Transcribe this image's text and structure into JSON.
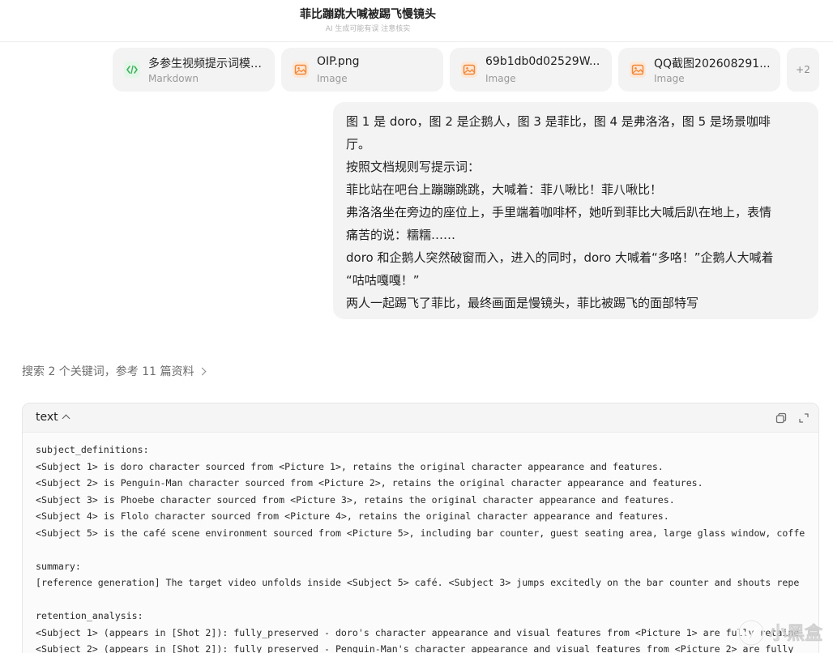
{
  "header": {
    "title": "菲比蹦跳大喊被踢飞慢镜头",
    "subtitle": "AI 生成可能有误 注意核实"
  },
  "attachments": [
    {
      "name": "多参生视频提示词模板...",
      "type": "Markdown",
      "icon": "markdown-code-icon"
    },
    {
      "name": "OIP.png",
      "type": "Image",
      "icon": "image-icon"
    },
    {
      "name": "69b1db0d02529W...",
      "type": "Image",
      "icon": "image-icon"
    },
    {
      "name": "QQ截图202608291...",
      "type": "Image",
      "icon": "image-icon"
    }
  ],
  "attachments_more": "+2",
  "user_message": {
    "lines": [
      "图 1 是 doro，图 2 是企鹅人，图 3 是菲比，图 4 是弗洛洛，图 5 是场景咖啡",
      "厅。",
      "按照文档规则写提示词：",
      "菲比站在吧台上蹦蹦跳跳，大喊着：菲八啾比！菲八啾比！",
      "弗洛洛坐在旁边的座位上，手里端着咖啡杯，她听到菲比大喊后趴在地上，表情",
      "痛苦的说：糯糯……",
      "doro 和企鹅人突然破窗而入，进入的同时，doro 大喊着“多咯！”企鹅人大喊着",
      "“咕咕嘎嘎！”",
      "两人一起踢飞了菲比，最终画面是慢镜头，菲比被踢飞的面部特写"
    ]
  },
  "search_summary": "搜索 2 个关键词，参考 11 篇资料",
  "code_block": {
    "language": "text",
    "lines": [
      "subject_definitions:",
      "<Subject 1> is doro character sourced from <Picture 1>, retains the original character appearance and features.",
      "<Subject 2> is Penguin-Man character sourced from <Picture 2>, retains the original character appearance and features.",
      "<Subject 3> is Phoebe character sourced from <Picture 3>, retains the original character appearance and features.",
      "<Subject 4> is Flolo character sourced from <Picture 4>, retains the original character appearance and features.",
      "<Subject 5> is the café scene environment sourced from <Picture 5>, including bar counter, guest seating area, large glass window, coffe",
      "",
      "summary:",
      "[reference generation] The target video unfolds inside <Subject 5> café. <Subject 3> jumps excitedly on the bar counter and shouts repe",
      "",
      "retention_analysis:",
      "<Subject 1> (appears in [Shot 2]): fully_preserved - doro's character appearance and visual features from <Picture 1> are fully retaine",
      "<Subject 2> (appears in [Shot 2]): fully_preserved - Penguin-Man's character appearance and visual features from <Picture 2> are fully"
    ]
  },
  "watermark": {
    "text": "小黑盒"
  },
  "colors": {
    "bubble": "#f3f3f3",
    "card": "#f3f3f3",
    "markdown_icon": "#3fb25b",
    "image_icon": "#f2883a"
  }
}
